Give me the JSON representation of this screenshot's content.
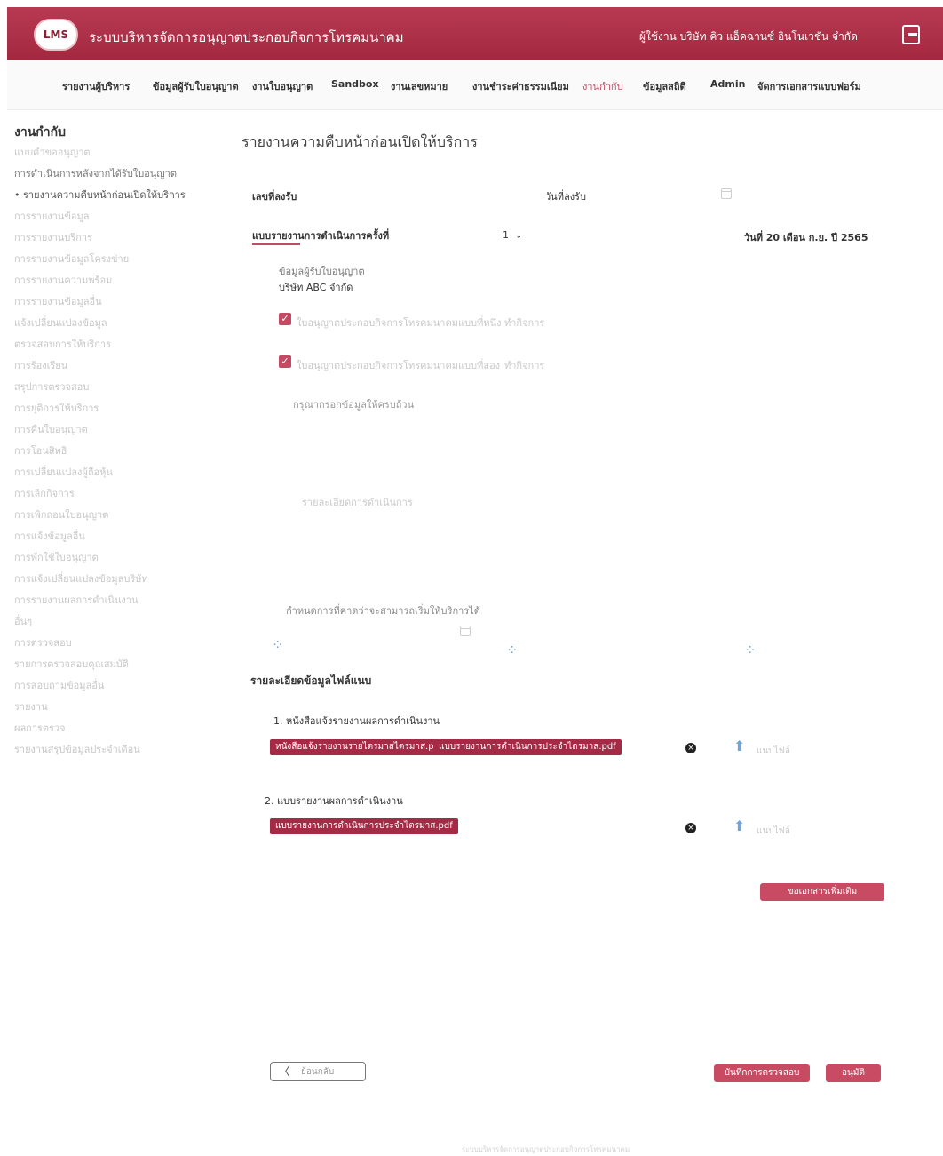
{
  "header": {
    "logo_text": "LMS",
    "app_title": "ระบบบริหารจัดการอนุญาตประกอบกิจการโทรคมนาคม",
    "user": "ผู้ใช้งาน บริษัท คิว แอ็คฉานซ์ อินโนเวชั่น จำกัด"
  },
  "nav": [
    "รายงานผู้บริหาร",
    "ข้อมูลผู้รับใบอนุญาต",
    "งานใบอนุญาต",
    "Sandbox",
    "งานเลขหมาย",
    "งานชำระค่าธรรมเนียม",
    "งานกำกับ",
    "ข้อมูลสถิติ",
    "Admin",
    "จัดการเอกสารแบบฟอร์ม"
  ],
  "sidebar": {
    "title": "งานกำกับ",
    "items": [
      "แบบคำขออนุญาต",
      "การดำเนินการหลังจากได้รับใบอนุญาต",
      "• รายงานความคืบหน้าก่อนเปิดให้บริการ",
      "การรายงานข้อมูล",
      "การรายงานบริการ",
      "การรายงานข้อมูลโครงข่าย",
      "การรายงานความพร้อม",
      "การรายงานข้อมูลอื่น",
      "แจ้งเปลี่ยนแปลงข้อมูล",
      "ตรวจสอบการให้บริการ",
      "การร้องเรียน",
      "สรุปการตรวจสอบ",
      "การยุติการให้บริการ",
      "การคืนใบอนุญาต",
      "การโอนสิทธิ",
      "การเปลี่ยนแปลงผู้ถือหุ้น",
      "การเลิกกิจการ",
      "การเพิกถอนใบอนุญาต",
      "การแจ้งข้อมูลอื่น",
      "การพักใช้ใบอนุญาต",
      "การแจ้งเปลี่ยนแปลงข้อมูลบริษัท",
      "การรายงานผลการดำเนินงาน",
      "อื่นๆ",
      "การตรวจสอบ",
      "รายการตรวจสอบคุณสมบัติ",
      "การสอบถามข้อมูลอื่น",
      "รายงาน",
      "ผลการตรวจ",
      "รายงานสรุปข้อมูลประจำเดือน"
    ]
  },
  "main": {
    "title": "รายงานความคืบหน้าก่อนเปิดให้บริการ",
    "receipt_no_label": "เลขที่ลงรับ",
    "receipt_date_label": "วันที่ลงรับ",
    "report_round_label": "แบบรายงานการดำเนินการครั้งที่",
    "report_round_value": "1",
    "date_text": "วันที่ 20 เดือน ก.ย. ปี 2565",
    "licensee_info_label": "ข้อมูลผู้รับใบอนุญาต",
    "licensee_name": "บริษัท ABC จำกัด",
    "license1": "ใบอนุญาตประกอบกิจการโทรคมนาคมแบบที่หนึ่ง",
    "license1_tail": "ทำกิจการ",
    "license2": "ใบอนุญาตประกอบกิจการโทรคมนาคมแบบที่สอง",
    "license2_tail": "ทำกิจการ",
    "fill_prompt": "กรุณากรอกข้อมูลให้ครบถ้วน",
    "detail_placeholder": "รายละเอียดการดำเนินการ",
    "schedule_label": "กำหนดการที่คาดว่าจะสามารถเริ่มให้บริการได้",
    "attach_title": "รายละเอียดข้อมูลไฟล์แนบ",
    "attach1_label": "1. หนังสือแจ้งรายงานผลการดำเนินงาน",
    "attach1_files": [
      "หนังสือแจ้งรายงานรายไตรมาสไตรมาส.pdf",
      "แบบรายงานการดำเนินการประจำไตรมาส.pdf"
    ],
    "attach2_label": "2. แบบรายงานผลการดำเนินงาน",
    "attach2_files": [
      "แบบรายงานการดำเนินการประจำไตรมาส.pdf"
    ],
    "upload_label": "แนบไฟล์",
    "request_docs_button": "ขอเอกสารเพิ่มเติม",
    "back_button": "ย้อนกลับ",
    "save_check_button": "บันทึกการตรวจสอบ",
    "approve_button": "อนุมัติ"
  },
  "footer": "ระบบบริหารจัดการอนุญาตประกอบกิจการโทรคมนาคม"
}
